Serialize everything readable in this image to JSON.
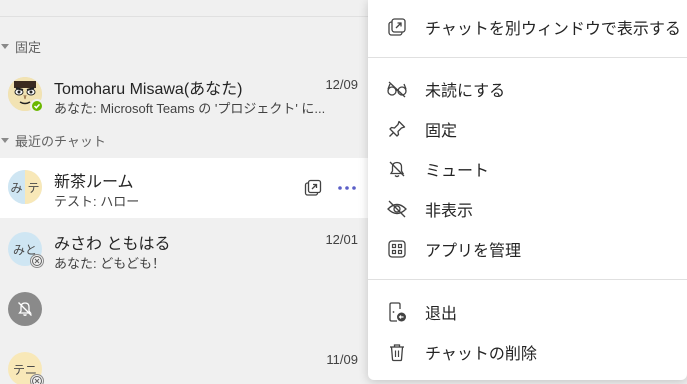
{
  "sections": {
    "pinned": "固定",
    "recent": "最近のチャット"
  },
  "chats": [
    {
      "name": "Tomoharu Misawa(あなた)",
      "preview": "あなた: Microsoft Teams の 'プロジェクト' に...",
      "date": "12/09",
      "status": "available"
    },
    {
      "name": "新茶ルーム",
      "preview": "テスト: ハロー",
      "avatar_text_1": "み",
      "avatar_text_2": "テ"
    },
    {
      "name": "みさわ ともはる",
      "preview": "あなた: どもども！",
      "date": "12/01",
      "avatar_text": "みと",
      "status": "offline"
    },
    {
      "name": "",
      "preview": "",
      "icon": "bell-off-icon"
    },
    {
      "name": "",
      "preview": "",
      "date": "11/09",
      "avatar_text": "テニ",
      "status": "offline"
    }
  ],
  "menu": {
    "items": [
      {
        "label": "チャットを別ウィンドウで表示する",
        "icon": "popout-icon"
      },
      {
        "label": "未読にする",
        "icon": "unread-glasses-icon"
      },
      {
        "label": "固定",
        "icon": "pin-icon"
      },
      {
        "label": "ミュート",
        "icon": "bell-off-icon"
      },
      {
        "label": "非表示",
        "icon": "eye-off-icon"
      },
      {
        "label": "アプリを管理",
        "icon": "apps-grid-icon"
      },
      {
        "label": "退出",
        "icon": "leave-icon"
      },
      {
        "label": "チャットの削除",
        "icon": "trash-icon"
      }
    ]
  },
  "colors": {
    "accent": "#5b5fc7",
    "available": "#6bb700",
    "list_bg": "#f0f0f0",
    "menu_bg": "#ffffff"
  }
}
